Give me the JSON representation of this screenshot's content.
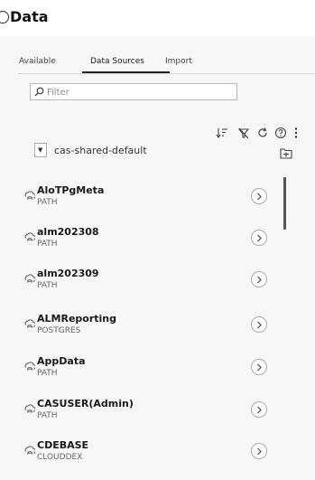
{
  "window": {
    "title": "Data"
  },
  "tabs": [
    {
      "label": "Available"
    },
    {
      "label": "Data Sources"
    },
    {
      "label": "Import"
    }
  ],
  "filter": {
    "placeholder": "Filter",
    "value": ""
  },
  "server": {
    "selected": "cas-shared-default"
  },
  "sources": [
    {
      "name": "AloTPgMeta",
      "engine": "PATH"
    },
    {
      "name": "alm202308",
      "engine": "PATH"
    },
    {
      "name": "alm202309",
      "engine": "PATH"
    },
    {
      "name": "ALMReporting",
      "engine": "POSTGRES"
    },
    {
      "name": "AppData",
      "engine": "PATH"
    },
    {
      "name": "CASUSER(Admin)",
      "engine": "PATH"
    },
    {
      "name": "CDEBASE",
      "engine": "CLOUDDEX"
    }
  ],
  "icons": {
    "toolbar": [
      "sort-icon",
      "filter-off-icon",
      "refresh-icon",
      "help-icon",
      "more-options-icon"
    ],
    "select": "chevron-down-icon",
    "new_folder": "new-folder-icon",
    "source": "library-icon",
    "open": "chevron-right-icon"
  },
  "colors": {
    "background": "#f7f7f7",
    "text": "#222222",
    "accent": "#222222"
  }
}
